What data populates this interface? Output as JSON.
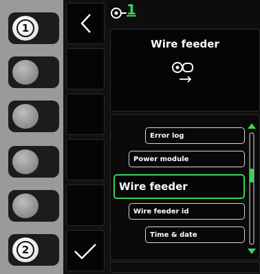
{
  "softkeys": [
    {
      "callout": "1"
    },
    {
      "callout": ""
    },
    {
      "callout": ""
    },
    {
      "callout": ""
    },
    {
      "callout": ""
    },
    {
      "callout": "2"
    }
  ],
  "header": {
    "wire_feeder_number": "1",
    "title": "Wire feeder",
    "icon": "wire-feeder-icon"
  },
  "menu": {
    "items": [
      {
        "label": "Error log",
        "selected": false
      },
      {
        "label": "Power module",
        "selected": false
      },
      {
        "label": "Wire feeder",
        "selected": true
      },
      {
        "label": "Wire feeder id",
        "selected": false
      },
      {
        "label": "Time & date",
        "selected": false
      }
    ],
    "scroll_position": 0.45
  },
  "colors": {
    "accent": "#39d55a",
    "screen_bg": "#111111",
    "bezel": "#9a9a9a"
  }
}
